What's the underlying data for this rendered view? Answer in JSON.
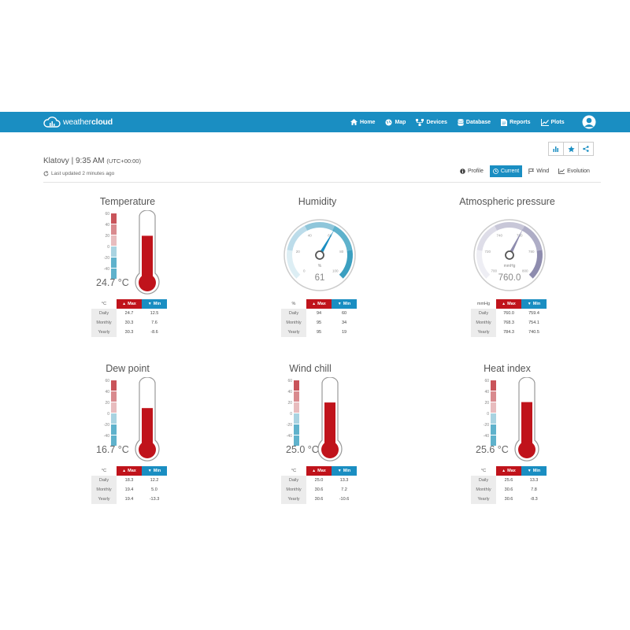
{
  "nav": {
    "logo_light": "weather",
    "logo_bold": "cloud",
    "items": [
      {
        "label": "Home",
        "icon": "home-icon"
      },
      {
        "label": "Map",
        "icon": "globe-icon"
      },
      {
        "label": "Devices",
        "icon": "devices-icon"
      },
      {
        "label": "Database",
        "icon": "database-icon"
      },
      {
        "label": "Reports",
        "icon": "report-icon"
      },
      {
        "label": "Plots",
        "icon": "chart-icon"
      }
    ]
  },
  "station": {
    "location": "Klatovy | 9:35 AM",
    "tz": "(UTC+00:00)",
    "updated": "Last updated 2 minutes ago"
  },
  "tabs": [
    {
      "label": "Profile",
      "icon": "info-icon",
      "active": false
    },
    {
      "label": "Current",
      "icon": "clock-icon",
      "active": true
    },
    {
      "label": "Wind",
      "icon": "flag-icon",
      "active": false
    },
    {
      "label": "Evolution",
      "icon": "line-chart-icon",
      "active": false
    }
  ],
  "table_headers": {
    "max": "Max",
    "min": "Min"
  },
  "row_labels": [
    "Daily",
    "Monthly",
    "Yearly"
  ],
  "scale_ticks": [
    "60",
    "40",
    "20",
    "0",
    "-20",
    "-40"
  ],
  "widgets": {
    "temperature": {
      "title": "Temperature",
      "value": "24.7 °C",
      "reading": 24.7,
      "unit": "°C",
      "rows": [
        [
          "24.7",
          "12.5"
        ],
        [
          "30.3",
          "7.6"
        ],
        [
          "30.3",
          "-8.6"
        ]
      ]
    },
    "humidity": {
      "title": "Humidity",
      "value": "61",
      "reading": 61,
      "unit": "%",
      "gauge_ticks": [
        "0",
        "20",
        "40",
        "60",
        "80",
        "100"
      ],
      "gauge_unit": "%",
      "rows": [
        [
          "94",
          "60"
        ],
        [
          "95",
          "34"
        ],
        [
          "95",
          "19"
        ]
      ]
    },
    "pressure": {
      "title": "Atmospheric pressure",
      "value": "760.0",
      "reading": 760.0,
      "unit": "mmHg",
      "gauge_ticks": [
        "700",
        "720",
        "740",
        "760",
        "780",
        "800"
      ],
      "gauge_unit": "mmHg",
      "rows": [
        [
          "760.0",
          "759.4"
        ],
        [
          "768.3",
          "754.1"
        ],
        [
          "784.3",
          "740.5"
        ]
      ]
    },
    "dewpoint": {
      "title": "Dew point",
      "value": "16.7 °C",
      "reading": 16.7,
      "unit": "°C",
      "rows": [
        [
          "18.3",
          "12.2"
        ],
        [
          "19.4",
          "5.0"
        ],
        [
          "19.4",
          "-13.3"
        ]
      ]
    },
    "windchill": {
      "title": "Wind chill",
      "value": "25.0 °C",
      "reading": 25.0,
      "unit": "°C",
      "rows": [
        [
          "25.0",
          "13.3"
        ],
        [
          "30.6",
          "7.2"
        ],
        [
          "30.6",
          "-10.6"
        ]
      ]
    },
    "heatindex": {
      "title": "Heat index",
      "value": "25.6 °C",
      "reading": 25.6,
      "unit": "°C",
      "rows": [
        [
          "25.6",
          "13.3"
        ],
        [
          "30.6",
          "7.8"
        ],
        [
          "30.6",
          "-8.3"
        ]
      ]
    }
  },
  "colors": {
    "navbar": "#1a8ec2",
    "max": "#c0131b",
    "min": "#1a8ec2",
    "mercury": "#c0131b"
  }
}
